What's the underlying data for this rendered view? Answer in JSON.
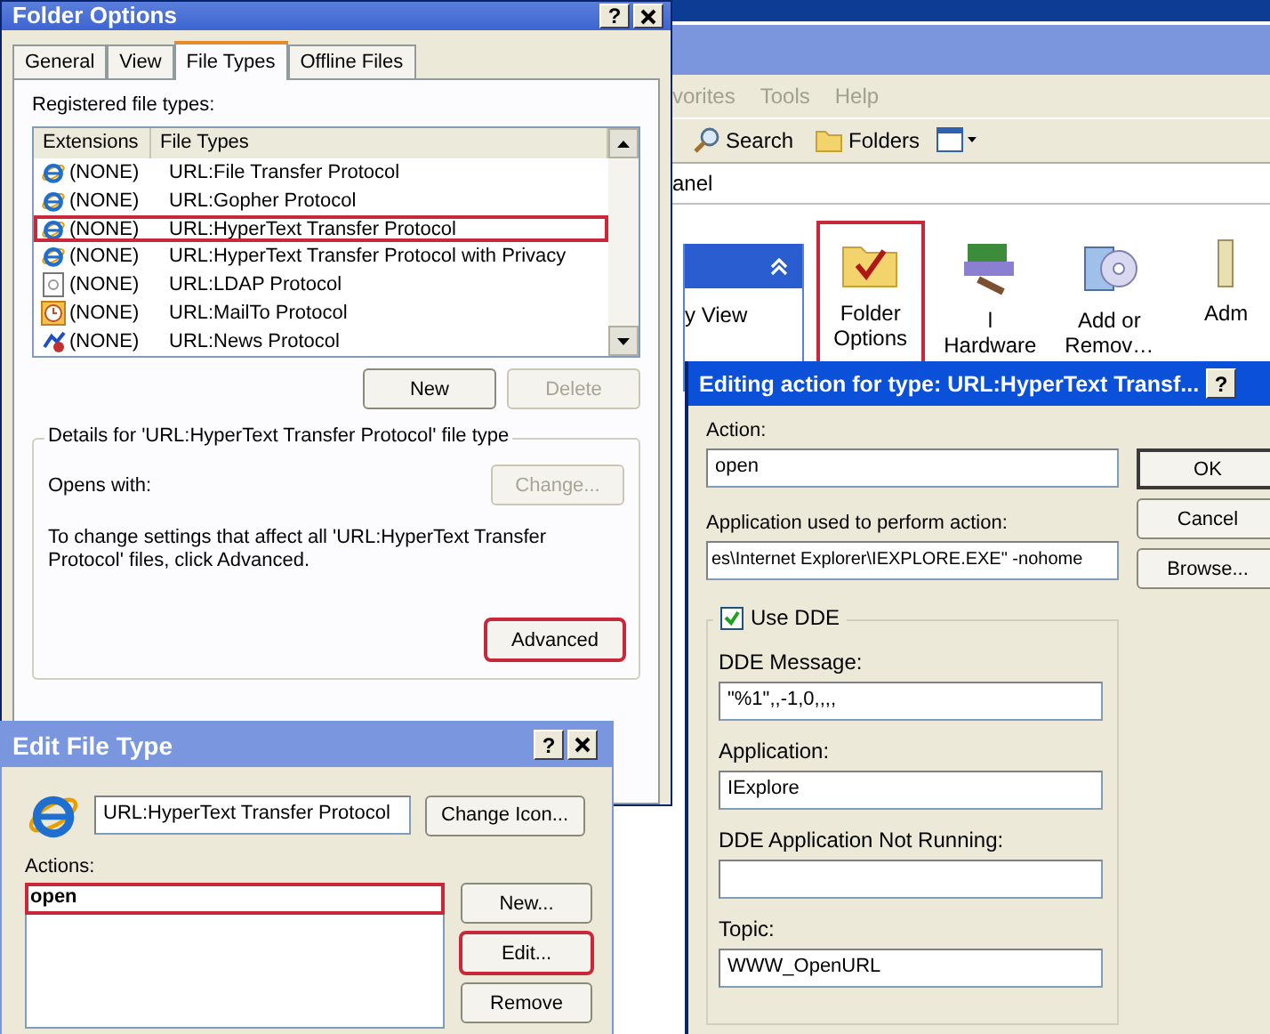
{
  "explorer": {
    "menu": [
      "vorites",
      "Tools",
      "Help"
    ],
    "toolbar": [
      {
        "label": "Search"
      },
      {
        "label": "Folders"
      }
    ],
    "address": "anel",
    "task_pane": {
      "item": "y View"
    },
    "items": [
      {
        "label": "Folder Options",
        "highlighted": true
      },
      {
        "label": "l Hardware",
        "highlighted": false
      },
      {
        "label": "Add or Remov…",
        "highlighted": false
      },
      {
        "label": "Adm",
        "highlighted": false
      }
    ]
  },
  "folder_options": {
    "title": "Folder Options",
    "help_button": "?",
    "tabs": [
      {
        "label": "General",
        "selected": false
      },
      {
        "label": "View",
        "selected": false
      },
      {
        "label": "File Types",
        "selected": true
      },
      {
        "label": "Offline Files",
        "selected": false
      }
    ],
    "registered_label": "Registered file types:",
    "columns": [
      "Extensions",
      "File Types"
    ],
    "rows": [
      {
        "extension": "(NONE)",
        "file_type": "URL:File Transfer Protocol",
        "highlighted": false
      },
      {
        "extension": "(NONE)",
        "file_type": "URL:Gopher Protocol",
        "highlighted": false
      },
      {
        "extension": "(NONE)",
        "file_type": "URL:HyperText Transfer Protocol",
        "highlighted": true
      },
      {
        "extension": "(NONE)",
        "file_type": "URL:HyperText Transfer Protocol with Privacy",
        "highlighted": false
      },
      {
        "extension": "(NONE)",
        "file_type": "URL:LDAP Protocol",
        "highlighted": false
      },
      {
        "extension": "(NONE)",
        "file_type": "URL:MailTo Protocol",
        "highlighted": false
      },
      {
        "extension": "(NONE)",
        "file_type": "URL:News Protocol",
        "highlighted": false
      }
    ],
    "buttons": [
      {
        "label": "New",
        "disabled": false
      },
      {
        "label": "Delete",
        "disabled": true
      }
    ],
    "details": {
      "legend": "Details for 'URL:HyperText Transfer Protocol' file type",
      "opens_with": "Opens with:",
      "change_button": {
        "label": "Change...",
        "disabled": true
      },
      "note": "To change settings that affect all 'URL:HyperText Transfer Protocol' files, click Advanced.",
      "advanced_button": {
        "label": "Advanced",
        "highlighted": true
      }
    }
  },
  "edit_file_type": {
    "title": "Edit File Type",
    "help_button": "?",
    "name_value": "URL:HyperText Transfer Protocol",
    "change_icon_button": "Change Icon...",
    "actions_label": "Actions:",
    "actions": [
      {
        "label": "open",
        "highlighted": true
      }
    ],
    "buttons": [
      {
        "label": "New...",
        "highlighted": false
      },
      {
        "label": "Edit...",
        "highlighted": true
      },
      {
        "label": "Remove",
        "highlighted": false
      }
    ]
  },
  "edit_action": {
    "title": "Editing action for type: URL:HyperText Transf...",
    "help_button": "?",
    "action_label": "Action:",
    "action_value": "open",
    "app_label": "Application used to perform action:",
    "app_value": "es\\Internet Explorer\\IEXPLORE.EXE\" -nohome",
    "buttons": [
      {
        "label": "OK",
        "default": true
      },
      {
        "label": "Cancel",
        "default": false
      },
      {
        "label": "Browse...",
        "default": false
      }
    ],
    "use_dde": {
      "label": "Use DDE",
      "checked": true
    },
    "fields": [
      {
        "label": "DDE Message:",
        "value": "\"%1\",,-1,0,,,,"
      },
      {
        "label": "Application:",
        "value": "IExplore"
      },
      {
        "label": "DDE Application Not Running:"
      },
      {
        "label": "Topic:",
        "value": "WWW_OpenURL"
      }
    ]
  }
}
